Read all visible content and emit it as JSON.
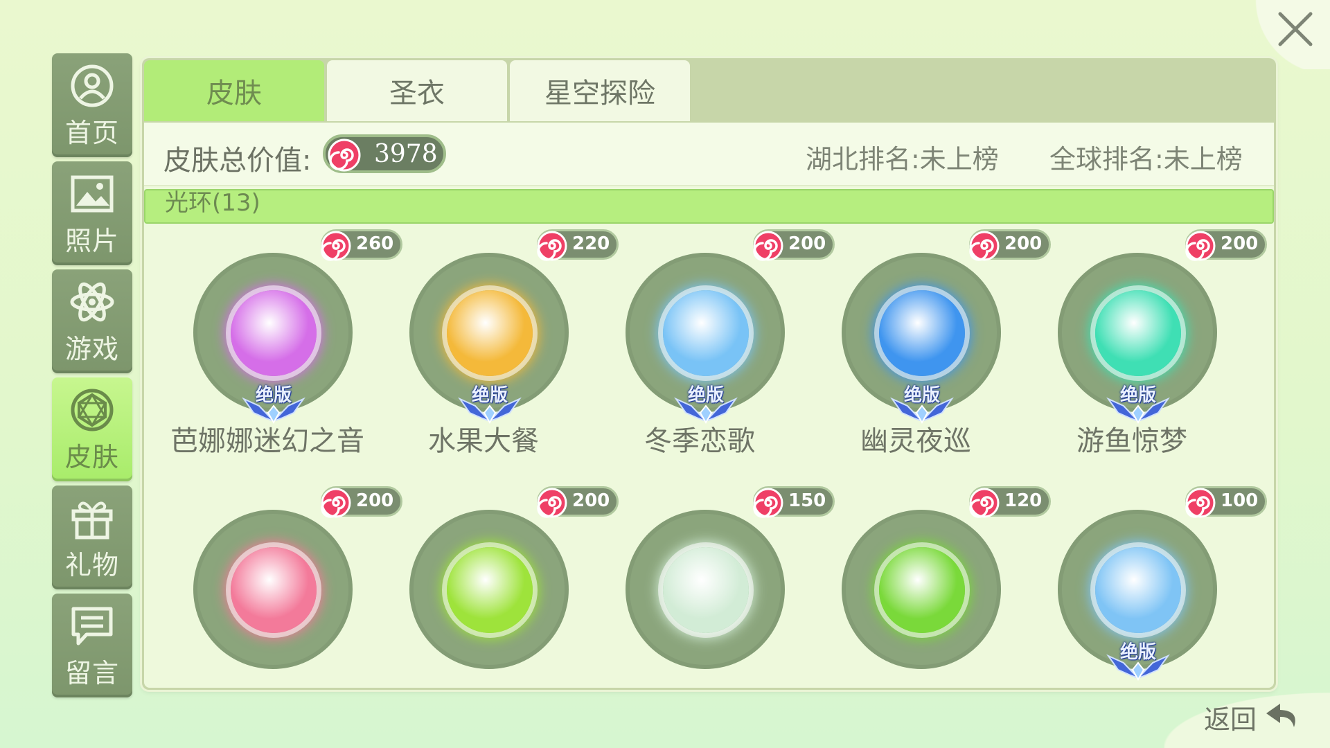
{
  "sidebar": {
    "items": [
      {
        "label": "首页",
        "icon": "user-icon"
      },
      {
        "label": "照片",
        "icon": "photo-icon"
      },
      {
        "label": "游戏",
        "icon": "atom-icon"
      },
      {
        "label": "皮肤",
        "icon": "gem-icon",
        "active": true
      },
      {
        "label": "礼物",
        "icon": "gift-icon"
      },
      {
        "label": "留言",
        "icon": "message-icon"
      }
    ]
  },
  "tabs": [
    {
      "label": "皮肤",
      "active": true
    },
    {
      "label": "圣衣"
    },
    {
      "label": "星空探险"
    }
  ],
  "stats": {
    "total_label": "皮肤总价值:",
    "total_value": "3978",
    "region_rank": "湖北排名:未上榜",
    "global_rank": "全球排名:未上榜"
  },
  "category": {
    "label": "光环(13)"
  },
  "badge_label": "绝版",
  "items": [
    {
      "name": "芭娜娜迷幻之音",
      "price": "260",
      "limited": true,
      "color": "#d56ee8"
    },
    {
      "name": "水果大餐",
      "price": "220",
      "limited": true,
      "color": "#f4b93a"
    },
    {
      "name": "冬季恋歌",
      "price": "200",
      "limited": true,
      "color": "#79c3f6"
    },
    {
      "name": "幽灵夜巡",
      "price": "200",
      "limited": true,
      "color": "#3f95ef"
    },
    {
      "name": "游鱼惊梦",
      "price": "200",
      "limited": true,
      "color": "#3fdfb4"
    },
    {
      "name": "",
      "price": "200",
      "limited": false,
      "color": "#f37a9a"
    },
    {
      "name": "",
      "price": "200",
      "limited": false,
      "color": "#9ee33b"
    },
    {
      "name": "",
      "price": "150",
      "limited": false,
      "color": "#d2ecd6"
    },
    {
      "name": "",
      "price": "120",
      "limited": false,
      "color": "#7ad93a"
    },
    {
      "name": "",
      "price": "100",
      "limited": true,
      "color": "#7fc4f5"
    }
  ],
  "back": {
    "label": "返回"
  },
  "colors": {
    "accent": "#b2ec78",
    "sidebar": "#8aa279",
    "candy": "#e9345b"
  }
}
